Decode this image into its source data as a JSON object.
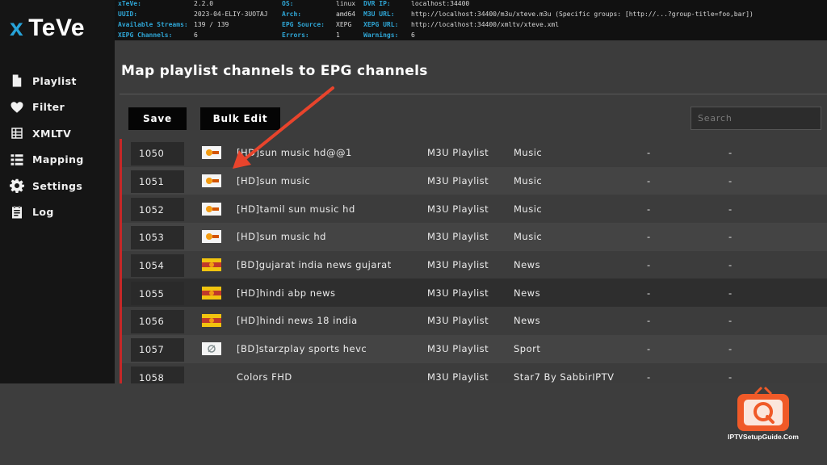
{
  "app": {
    "logo_x": "x",
    "logo_name": "TeVe"
  },
  "sidebar": {
    "items": [
      {
        "label": "Playlist",
        "icon": "file-icon"
      },
      {
        "label": "Filter",
        "icon": "heart-icon"
      },
      {
        "label": "XMLTV",
        "icon": "grid-icon"
      },
      {
        "label": "Mapping",
        "icon": "list-icon"
      },
      {
        "label": "Settings",
        "icon": "gear-icon"
      },
      {
        "label": "Log",
        "icon": "log-icon"
      }
    ]
  },
  "info": {
    "xteve_k": "xTeVe:",
    "xteve_v": "2.2.0",
    "uuid_k": "UUID:",
    "uuid_v": "2023-04-ELIY-3UOTAJ",
    "streams_k": "Available Streams:",
    "streams_v": "139 / 139",
    "xepg_k": "XEPG Channels:",
    "xepg_v": "6",
    "os_k": "OS:",
    "os_v": "linux",
    "arch_k": "Arch:",
    "arch_v": "amd64",
    "epgsrc_k": "EPG Source:",
    "epgsrc_v": "XEPG",
    "errors_k": "Errors:",
    "errors_v": "1",
    "dvr_k": "DVR IP:",
    "dvr_v": "localhost:34400",
    "m3u_k": "M3U URL:",
    "m3u_v": "http://localhost:34400/m3u/xteve.m3u (Specific groups: [http://...?group-title=foo,bar])",
    "xepgurl_k": "XEPG URL:",
    "xepgurl_v": "http://localhost:34400/xmltv/xteve.xml",
    "warn_k": "Warnings:",
    "warn_v": "6"
  },
  "page": {
    "title": "Map playlist channels to EPG channels",
    "save_label": "Save",
    "bulk_label": "Bulk Edit",
    "search_placeholder": "Search"
  },
  "colors": {
    "accent": "#27a3d9",
    "row_border": "#c62828",
    "arrow": "#e8442c",
    "watermark": "#f05a28"
  },
  "rows": [
    {
      "num": "1050",
      "logo": "sun",
      "name": "[HD]sun music hd@@1",
      "source": "M3U Playlist",
      "group": "Music",
      "d1": "-",
      "d2": "-"
    },
    {
      "num": "1051",
      "logo": "sun",
      "name": "[HD]sun music",
      "source": "M3U Playlist",
      "group": "Music",
      "d1": "-",
      "d2": "-"
    },
    {
      "num": "1052",
      "logo": "sun",
      "name": "[HD]tamil sun music hd",
      "source": "M3U Playlist",
      "group": "Music",
      "d1": "-",
      "d2": "-"
    },
    {
      "num": "1053",
      "logo": "sun",
      "name": "[HD]sun music hd",
      "source": "M3U Playlist",
      "group": "Music",
      "d1": "-",
      "d2": "-"
    },
    {
      "num": "1054",
      "logo": "news",
      "name": "[BD]gujarat india news gujarat",
      "source": "M3U Playlist",
      "group": "News",
      "d1": "-",
      "d2": "-"
    },
    {
      "num": "1055",
      "logo": "news",
      "name": "[HD]hindi abp news",
      "source": "M3U Playlist",
      "group": "News",
      "d1": "-",
      "d2": "-"
    },
    {
      "num": "1056",
      "logo": "news",
      "name": "[HD]hindi news 18 india",
      "source": "M3U Playlist",
      "group": "News",
      "d1": "-",
      "d2": "-"
    },
    {
      "num": "1057",
      "logo": "sport",
      "name": "[BD]starzplay sports hevc",
      "source": "M3U Playlist",
      "group": "Sport",
      "d1": "-",
      "d2": "-"
    },
    {
      "num": "1058",
      "logo": "none",
      "name": "Colors FHD",
      "source": "M3U Playlist",
      "group": "Star7 By SabbirIPTV",
      "d1": "-",
      "d2": "-"
    }
  ],
  "watermark": {
    "text": "IPTVSetupGuide.Com"
  }
}
